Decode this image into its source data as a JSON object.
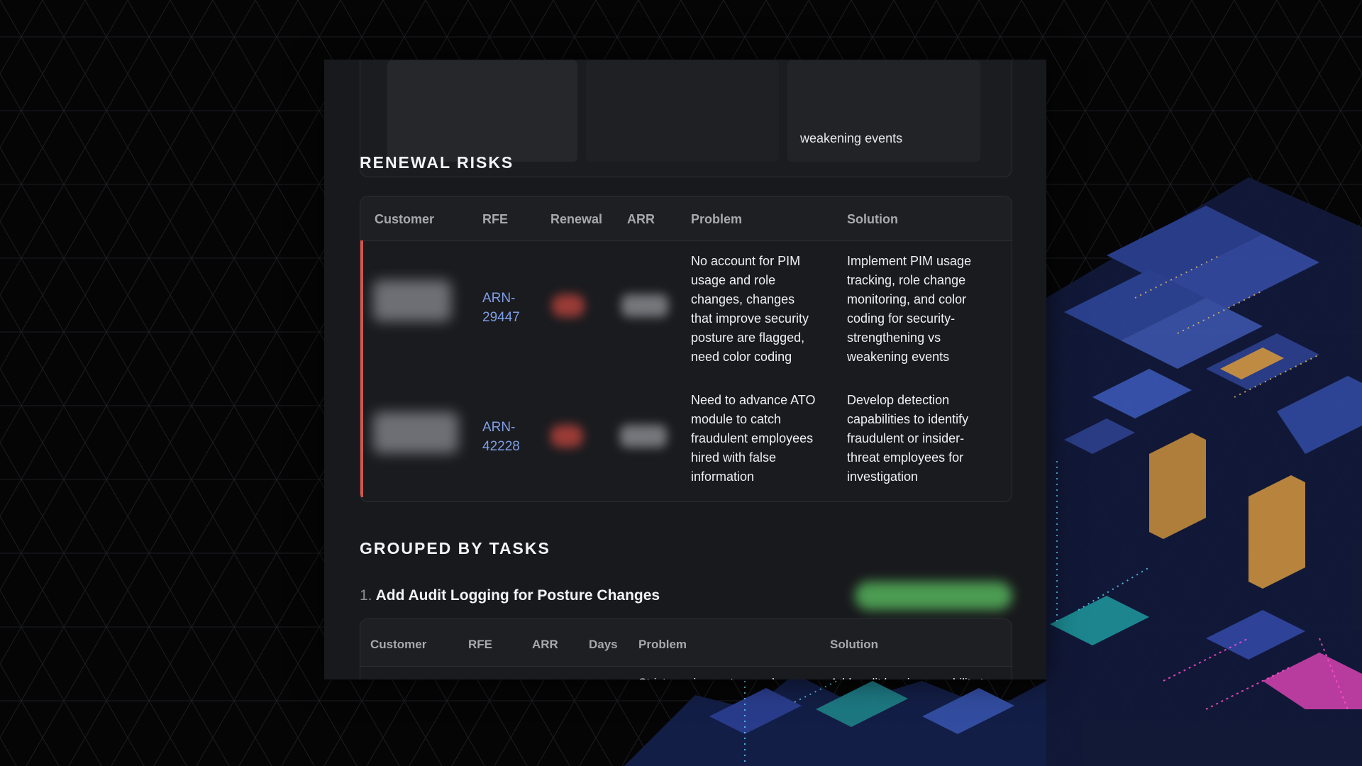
{
  "previous_card": {
    "text": "weakening events"
  },
  "renewal_risks": {
    "title": "RENEWAL RISKS",
    "columns": [
      "Customer",
      "RFE",
      "Renewal",
      "ARR",
      "Problem",
      "Solution"
    ],
    "rows": [
      {
        "rfe": "ARN-29447",
        "rfe_lines": [
          "ARN-",
          "29447"
        ],
        "problem_lines": [
          "No account for PIM",
          "usage and role",
          "changes, changes",
          "that improve security",
          "posture are flagged,",
          "need color coding"
        ],
        "solution_lines": [
          "Implement PIM usage",
          "tracking, role change",
          "monitoring, and color",
          "coding for security-",
          "strengthening vs",
          "weakening events"
        ]
      },
      {
        "rfe": "ARN-42228",
        "rfe_lines": [
          "ARN-",
          "42228"
        ],
        "problem_lines": [
          "Need to advance ATO",
          "module to catch",
          "fraudulent employees",
          "hired with false",
          "information"
        ],
        "solution_lines": [
          "Develop detection",
          "capabilities to identify",
          "fraudulent or insider-",
          "threat employees for",
          "investigation"
        ]
      }
    ],
    "risk_color": "#d4554c"
  },
  "grouped_by_tasks": {
    "title": "GROUPED BY TASKS",
    "task_number": "1.",
    "task_title": "Add Audit Logging for Posture Changes",
    "columns": [
      "Customer",
      "RFE",
      "ARR",
      "Days",
      "Problem",
      "Solution"
    ],
    "first_row_problem": "Strict requirement around",
    "first_row_solution": "Add audit logging capability to"
  },
  "colors": {
    "link": "#7f9ee6",
    "window_bg": "#18191c",
    "badge": "#55b35c"
  }
}
